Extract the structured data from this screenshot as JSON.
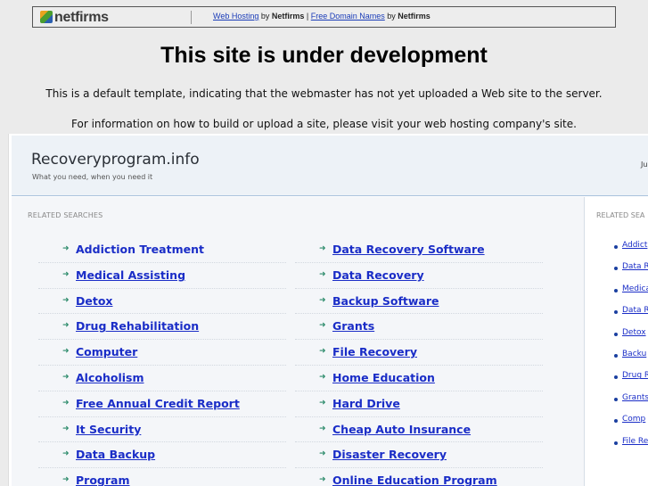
{
  "banner": {
    "logo_text": "netfirms",
    "link1": "Web Hosting",
    "by1": " by ",
    "brand1": "Netfirms",
    "sep": " | ",
    "link2": "Free Domain Names",
    "by2": " by ",
    "brand2": "Netfirms"
  },
  "headline": "This site is under development",
  "info_line1": "This is a default template, indicating that the webmaster has not yet uploaded a Web site to the server.",
  "info_line2": "For information on how to build or upload a site, please visit your web hosting company's site.",
  "site": {
    "title": "Recoveryprogram.info",
    "tagline": "What you need, when you need it",
    "date_fragment": "Ju"
  },
  "related_label": "RELATED SEARCHES",
  "related_col1": [
    "Addiction Treatment",
    "Medical Assisting",
    "Detox",
    "Drug Rehabilitation",
    "Computer",
    "Alcoholism",
    "Free Annual Credit Report",
    "It Security",
    "Data Backup",
    "Program"
  ],
  "related_col2": [
    "Data Recovery Software",
    "Data Recovery",
    "Backup Software",
    "Grants",
    "File Recovery",
    "Home Education",
    "Hard Drive",
    "Cheap Auto Insurance",
    "Disaster Recovery",
    "Online Education Program"
  ],
  "side_label": "RELATED SEA",
  "side_items": [
    "Addict",
    "Data R",
    "Medica",
    "Data R",
    "Detox",
    "Backu",
    "Drug R",
    "Grants",
    "Comp",
    "File Re"
  ],
  "colors": {
    "link": "#1a2dc7",
    "arrow": "#2e8c6c",
    "header_bg": "#edf2f7"
  }
}
